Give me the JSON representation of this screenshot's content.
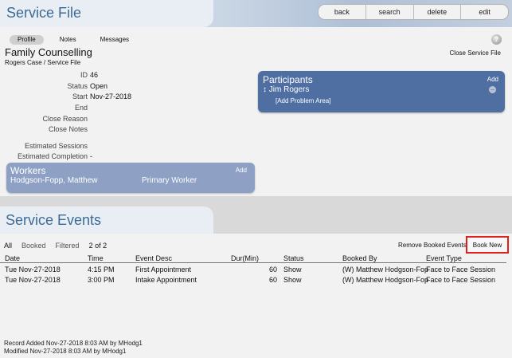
{
  "header": {
    "title": "Service File"
  },
  "toolbar": {
    "back": "back",
    "search": "search",
    "delete": "delete",
    "edit": "edit"
  },
  "profile": {
    "tabs": [
      "Profile",
      "Notes",
      "Messages"
    ],
    "active_tab": "Profile",
    "help_icon": "help-icon",
    "close_link": "Close Service File",
    "case_title": "Family Counselling",
    "case_path": "Rogers Case / Service File",
    "fields": [
      {
        "label": "ID",
        "value": "46"
      },
      {
        "label": "Status",
        "value": "Open"
      },
      {
        "label": "Start",
        "value": "Nov-27-2018"
      },
      {
        "label": "End",
        "value": ""
      },
      {
        "label": "Close Reason",
        "value": ""
      },
      {
        "label": "Close Notes",
        "value": ""
      },
      {
        "label": "Estimated Sessions",
        "value": ""
      },
      {
        "label": "Estimated Completion",
        "value": "-"
      }
    ]
  },
  "participants": {
    "title": "Participants",
    "add": "Add",
    "name": "Jim Rogers",
    "name_icon": "drag-handle-icon",
    "remove_icon": "minus-circle-icon",
    "problem_area": "[Add Problem Area]"
  },
  "workers": {
    "title": "Workers",
    "add": "Add",
    "name": "Hodgson-Fopp, Matthew",
    "role": "Primary Worker"
  },
  "events": {
    "title": "Service Events",
    "filters": [
      "All",
      "Booked",
      "Filtered"
    ],
    "count": "2 of 2",
    "remove_booked": "Remove Booked Events",
    "book_new": "Book New",
    "columns": [
      "Date",
      "Time",
      "Event Desc",
      "Dur(Min)",
      "Status",
      "Booked By",
      "Event Type"
    ],
    "rows": [
      [
        "Tue Nov-27-2018",
        "4:15 PM",
        "First Appointment",
        "60",
        "Show",
        "(W) Matthew Hodgson-Fop",
        "Face to Face Session"
      ],
      [
        "Tue Nov-27-2018",
        "3:00 PM",
        "Intake Appointment",
        "60",
        "Show",
        "(W) Matthew Hodgson-Fop",
        "Face to Face Session"
      ]
    ]
  },
  "footer": {
    "added": "Record Added Nov-27-2018 8:03 AM by MHodg1",
    "modified": "Modified Nov-27-2018 8:03 AM by MHodg1"
  },
  "colors": {
    "title_blue": "#3d6a96",
    "participants_bg": "#4f6fa3",
    "workers_bg": "#8ea1c5",
    "highlight_red": "#e0201a"
  }
}
